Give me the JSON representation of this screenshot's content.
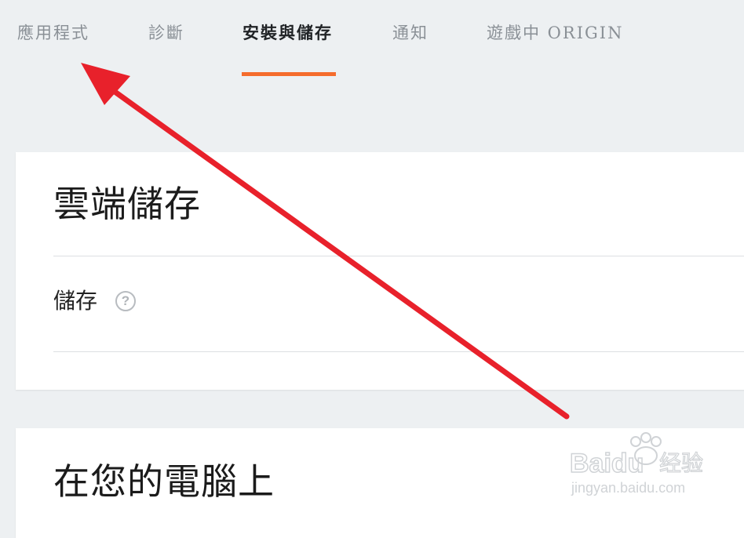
{
  "tabs": [
    {
      "label": "應用程式",
      "active": false
    },
    {
      "label": "診斷",
      "active": false
    },
    {
      "label": "安裝與儲存",
      "active": true
    },
    {
      "label": "通知",
      "active": false
    },
    {
      "label": "遊戲中 ORIGIN",
      "active": false
    }
  ],
  "cloud_section": {
    "title": "雲端儲存",
    "storage_label": "儲存",
    "help_glyph": "?"
  },
  "pc_section": {
    "title": "在您的電腦上"
  },
  "watermark": {
    "brand": "Baidu",
    "product": "经验",
    "url": "jingyan.baidu.com"
  },
  "colors": {
    "accent": "#f56c2d",
    "annotation_arrow": "#e8212b"
  }
}
